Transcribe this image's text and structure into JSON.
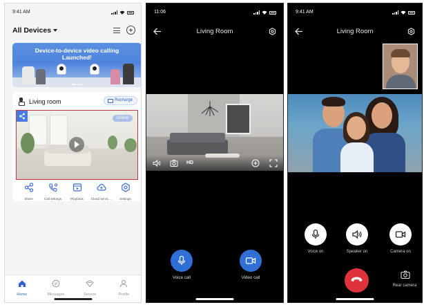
{
  "phone1": {
    "status_time": "9:41 AM",
    "header_title": "All Devices",
    "banner": {
      "line1": "Device-to-device video calling",
      "line2": "Launched!"
    },
    "room": {
      "name": "Living room",
      "recharge_label": "Recharge",
      "online_label": "Online"
    },
    "tools": [
      {
        "label": "Share",
        "icon": "share-icon"
      },
      {
        "label": "Call settings",
        "icon": "phone-settings-icon"
      },
      {
        "label": "Playback",
        "icon": "playback-icon"
      },
      {
        "label": "Cloud servic...",
        "icon": "cloud-icon"
      },
      {
        "label": "Settings",
        "icon": "gear-icon"
      }
    ],
    "tabs": [
      {
        "label": "Home",
        "icon": "home-icon",
        "active": true
      },
      {
        "label": "Messages",
        "icon": "message-icon",
        "active": false
      },
      {
        "label": "Service",
        "icon": "service-icon",
        "active": false
      },
      {
        "label": "Profile",
        "icon": "profile-icon",
        "active": false
      }
    ],
    "accent": "#2e62d0"
  },
  "phone2": {
    "status_time": "11:06",
    "title": "Living Room",
    "hd_label": "HD",
    "voice_call_label": "Voice call",
    "video_call_label": "Video call",
    "accent": "#2f6fd6"
  },
  "phone3": {
    "status_time": "9:41 AM",
    "title": "Living Room",
    "voice_on_label": "Voice on",
    "speaker_on_label": "Speaker on",
    "camera_on_label": "Camera on",
    "rear_camera_label": "Rear camera",
    "hangup_color": "#e0323c"
  }
}
